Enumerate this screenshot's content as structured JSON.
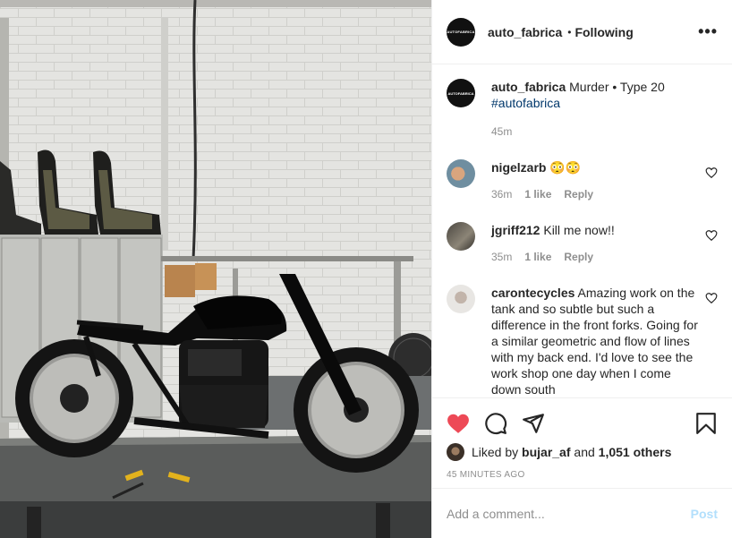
{
  "post": {
    "author": "auto_fabrica",
    "author_avatar_text": "AUTOFABRICA",
    "follow_dot": "•",
    "follow_status": "Following",
    "more_label": "•••",
    "caption_author": "auto_fabrica",
    "caption_text": "Murder • Type 20",
    "caption_hashtag": "#autofabrica",
    "caption_time": "45m"
  },
  "comments": [
    {
      "user": "nigelzarb",
      "text": "😳😳",
      "time": "36m",
      "likes": "1 like",
      "reply": "Reply"
    },
    {
      "user": "jgriff212",
      "text": "Kill me now!!",
      "time": "35m",
      "likes": "1 like",
      "reply": "Reply"
    },
    {
      "user": "carontecycles",
      "text": "Amazing work on the tank and so subtle but such a difference in the front forks. Going for a similar geometric and flow of lines with my back end. I'd love to see the work shop one day when I come down south",
      "time": "",
      "likes": "",
      "reply": ""
    }
  ],
  "actions": {
    "liked_prefix": "Liked by",
    "liked_user": "bujar_af",
    "liked_and": "and",
    "liked_count": "1,051 others",
    "timestamp": "45 MINUTES AGO"
  },
  "composer": {
    "placeholder": "Add a comment...",
    "post_label": "Post"
  },
  "colors": {
    "like_red": "#ed4956",
    "hashtag": "#00376b",
    "post_disabled": "#b2dffc",
    "meta_gray": "#8e8e8e"
  },
  "icons": [
    "heart-filled-icon",
    "comment-icon",
    "share-icon",
    "bookmark-icon",
    "more-icon",
    "small-heart-icon"
  ]
}
